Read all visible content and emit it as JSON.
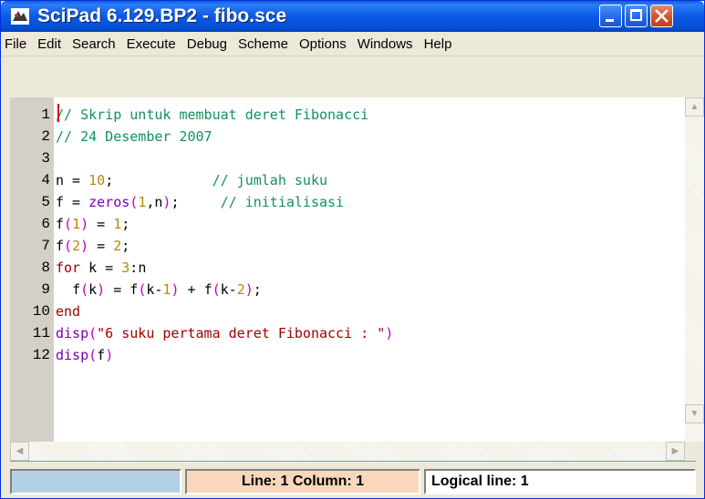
{
  "window": {
    "title": "SciPad 6.129.BP2 - fibo.sce"
  },
  "menu": [
    "File",
    "Edit",
    "Search",
    "Execute",
    "Debug",
    "Scheme",
    "Options",
    "Windows",
    "Help"
  ],
  "editor": {
    "line_numbers": [
      "1",
      "2",
      "3",
      "4",
      "5",
      "6",
      "7",
      "8",
      "9",
      "10",
      "11",
      "12"
    ],
    "lines": [
      "// Skrip untuk membuat deret Fibonacci",
      "// 24 Desember 2007",
      "",
      "n = 10;            // jumlah suku",
      "f = zeros(1,n);     // initialisasi",
      "f(1) = 1;",
      "f(2) = 2;",
      "for k = 3:n",
      "  f(k) = f(k-1) + f(k-2);",
      "end",
      "disp(\"6 suku pertama deret Fibonacci : \")",
      "disp(f)"
    ]
  },
  "status": {
    "blank": "",
    "position": "Line: 1 Column: 1",
    "logical": "Logical line: 1"
  },
  "colors": {
    "comment": "#12925a",
    "number": "#b8860b",
    "keyword": "#a00000",
    "function": "#7a00b0",
    "titlebar": "#0b59e5"
  },
  "icons": [
    "scipad-app-icon",
    "minimize-icon",
    "maximize-icon",
    "close-icon",
    "scroll-up-icon",
    "scroll-down-icon",
    "scroll-left-icon",
    "scroll-right-icon"
  ]
}
